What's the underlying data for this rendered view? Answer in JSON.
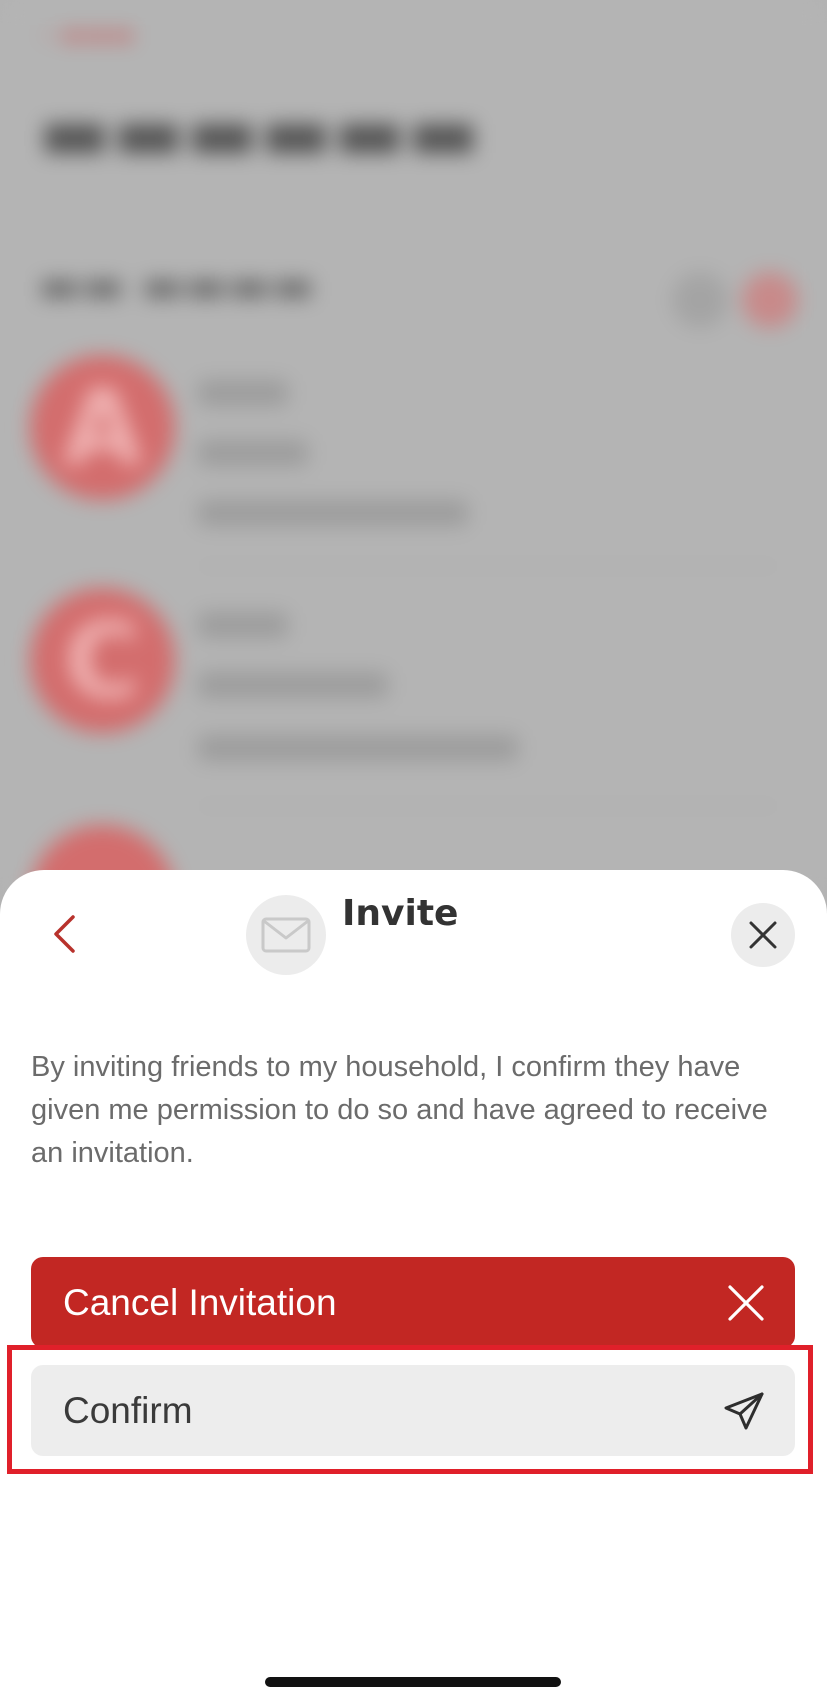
{
  "sheet": {
    "title": "Invite",
    "consent_text": "By inviting friends to my household, I confirm they have given me permission to do so and have agreed to receive an invitation.",
    "cancel_label": "Cancel Invitation",
    "confirm_label": "Confirm"
  },
  "icons": {
    "back": "chevron-left-icon",
    "header": "envelope-icon",
    "close": "close-icon",
    "cancel": "close-icon",
    "confirm": "send-icon"
  },
  "colors": {
    "accent_red": "#c22723",
    "back_chevron": "#b8322c",
    "highlight": "#e0202a",
    "button_grey": "#ededed"
  }
}
